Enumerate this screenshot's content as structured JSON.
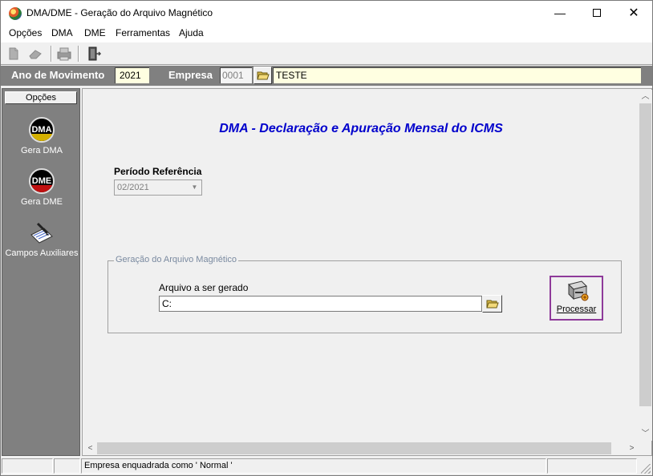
{
  "window": {
    "title": "DMA/DME - Geração do Arquivo Magnético",
    "minimize_symbol": "—",
    "close_symbol": "✕"
  },
  "menu": {
    "items": [
      "Opções",
      "DMA",
      "DME",
      "Ferramentas",
      "Ajuda"
    ]
  },
  "header": {
    "year_label": "Ano de Movimento",
    "year_value": "2021",
    "company_label": "Empresa",
    "company_code": "0001",
    "company_name": "TESTE"
  },
  "sidebar": {
    "heading": "Opções",
    "items": [
      {
        "label": "Gera DMA",
        "badge": "DMA"
      },
      {
        "label": "Gera DME",
        "badge": "DME"
      },
      {
        "label": "Campos Auxiliares"
      }
    ]
  },
  "main": {
    "title": "DMA - Declaração e Apuração Mensal do ICMS",
    "period_label": "Período Referência",
    "period_value": "02/2021",
    "group_title": "Geração do Arquivo Magnético",
    "file_label": "Arquivo a ser gerado",
    "file_value": "C:",
    "process_button": "Processar"
  },
  "statusbar": {
    "message": "Empresa enquadrada como ' Normal '"
  },
  "colors": {
    "title_blue": "#0000cc",
    "header_gray": "#808080",
    "highlight_yellow": "#ffffe1",
    "focus_purple": "#8e3a9a"
  }
}
